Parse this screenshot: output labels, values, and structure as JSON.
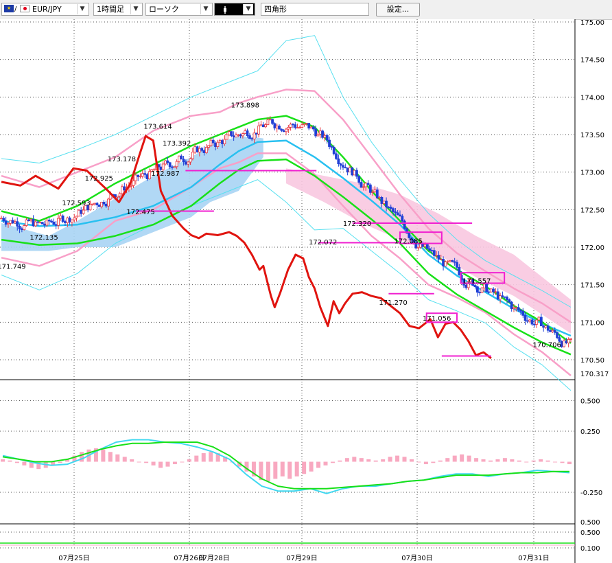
{
  "toolbar": {
    "symbol": "EUR/JPY",
    "timeframe": "1時間足",
    "chart_type": "ローソク",
    "draw_tool_icon": "line-tool-icon",
    "shape": "四角形",
    "settings": "設定..."
  },
  "colors": {
    "candle_up": "#e8323c",
    "candle_down": "#1f3fd6",
    "chikou": "#e0140f",
    "bb_inner": "#f8a0c8",
    "bb_outer": "#58e0f0",
    "ma_short": "#18e018",
    "ma_long": "#28c0f0",
    "kumo_blue": "#a8d4f4",
    "kumo_pink": "#f8c8e0",
    "magenta": "#f020d0"
  },
  "chart_data": {
    "type": "candlestick",
    "price_ticks": [
      "175.00",
      "174.50",
      "174.00",
      "173.50",
      "173.00",
      "172.50",
      "172.00",
      "171.50",
      "171.00",
      "170.50"
    ],
    "current_price": "170.317",
    "x_labels": [
      "07月25日",
      "07月26日",
      "07月28日",
      "07月29日",
      "07月30日",
      "07月31日"
    ],
    "ylim": [
      170.317,
      175.0
    ],
    "price_labels": [
      {
        "text": "171.749",
        "x": 3,
        "y": 171.749
      },
      {
        "text": "172.135",
        "x": 20,
        "y": 172.135
      },
      {
        "text": "172.593",
        "x": 37,
        "y": 172.593
      },
      {
        "text": "172.925",
        "x": 49,
        "y": 172.925
      },
      {
        "text": "173.178",
        "x": 61,
        "y": 173.178
      },
      {
        "text": "172.475",
        "x": 71,
        "y": 172.475
      },
      {
        "text": "173.614",
        "x": 80,
        "y": 173.614
      },
      {
        "text": "172.987",
        "x": 84,
        "y": 172.987
      },
      {
        "text": "173.392",
        "x": 90,
        "y": 173.392
      },
      {
        "text": "173.898",
        "x": 126,
        "y": 173.898
      },
      {
        "text": "172.072",
        "x": 167,
        "y": 172.072
      },
      {
        "text": "172.320",
        "x": 185,
        "y": 172.32
      },
      {
        "text": "172.085",
        "x": 212,
        "y": 172.085
      },
      {
        "text": "171.270",
        "x": 204,
        "y": 171.27
      },
      {
        "text": "171.056",
        "x": 227,
        "y": 171.056
      },
      {
        "text": "171.557",
        "x": 248,
        "y": 171.557
      },
      {
        "text": "170.706",
        "x": 285,
        "y": 170.706
      }
    ],
    "series": [
      {
        "name": "",
        "role": "candles",
        "values": "[open, high, low, close] per hourly bar, 300 bars"
      },
      {
        "name": "",
        "role": "chikou"
      },
      {
        "name": "",
        "role": "ma_short"
      },
      {
        "name": "",
        "role": "ma_long"
      },
      {
        "name": "",
        "role": "bb_inner"
      },
      {
        "name": "",
        "role": "bb_outer"
      }
    ],
    "chikou": [
      [
        0,
        172.87
      ],
      [
        10,
        172.82
      ],
      [
        18,
        172.95
      ],
      [
        30,
        172.78
      ],
      [
        38,
        173.05
      ],
      [
        45,
        173.02
      ],
      [
        55,
        172.78
      ],
      [
        62,
        172.6
      ],
      [
        68,
        172.85
      ],
      [
        73,
        173.25
      ],
      [
        76,
        173.48
      ],
      [
        80,
        173.42
      ],
      [
        84,
        172.75
      ],
      [
        90,
        172.42
      ],
      [
        96,
        172.25
      ],
      [
        100,
        172.16
      ],
      [
        104,
        172.12
      ],
      [
        108,
        172.18
      ],
      [
        114,
        172.16
      ],
      [
        120,
        172.2
      ],
      [
        124,
        172.15
      ],
      [
        128,
        172.06
      ],
      [
        132,
        171.9
      ],
      [
        136,
        171.7
      ],
      [
        138,
        171.75
      ],
      [
        140,
        171.55
      ],
      [
        142,
        171.35
      ],
      [
        144,
        171.2
      ],
      [
        147,
        171.4
      ],
      [
        151,
        171.7
      ],
      [
        155,
        171.9
      ],
      [
        159,
        171.85
      ],
      [
        162,
        171.6
      ],
      [
        165,
        171.45
      ],
      [
        168,
        171.2
      ],
      [
        172,
        170.95
      ],
      [
        175,
        171.28
      ],
      [
        178,
        171.12
      ],
      [
        181,
        171.25
      ],
      [
        185,
        171.38
      ],
      [
        190,
        171.4
      ],
      [
        195,
        171.35
      ],
      [
        200,
        171.32
      ],
      [
        205,
        171.22
      ],
      [
        210,
        171.12
      ],
      [
        215,
        170.95
      ],
      [
        220,
        170.92
      ],
      [
        226,
        171.04
      ],
      [
        230,
        170.8
      ],
      [
        234,
        170.98
      ],
      [
        238,
        171.0
      ],
      [
        242,
        170.9
      ],
      [
        246,
        170.75
      ],
      [
        250,
        170.56
      ],
      [
        254,
        170.6
      ],
      [
        258,
        170.52
      ]
    ],
    "ma_short": [
      [
        0,
        172.48
      ],
      [
        20,
        172.35
      ],
      [
        40,
        172.55
      ],
      [
        60,
        172.85
      ],
      [
        80,
        173.1
      ],
      [
        100,
        173.35
      ],
      [
        115,
        173.5
      ],
      [
        125,
        173.6
      ],
      [
        135,
        173.7
      ],
      [
        150,
        173.75
      ],
      [
        165,
        173.6
      ],
      [
        180,
        173.2
      ],
      [
        195,
        172.75
      ],
      [
        210,
        172.35
      ],
      [
        225,
        171.95
      ],
      [
        240,
        171.7
      ],
      [
        255,
        171.48
      ],
      [
        270,
        171.22
      ],
      [
        285,
        171.0
      ],
      [
        300,
        170.72
      ]
    ],
    "ma_long": [
      [
        0,
        172.35
      ],
      [
        20,
        172.28
      ],
      [
        40,
        172.3
      ],
      [
        60,
        172.4
      ],
      [
        80,
        172.55
      ],
      [
        100,
        172.8
      ],
      [
        115,
        173.1
      ],
      [
        125,
        173.28
      ],
      [
        135,
        173.4
      ],
      [
        150,
        173.42
      ],
      [
        165,
        173.2
      ],
      [
        180,
        172.92
      ],
      [
        195,
        172.62
      ],
      [
        210,
        172.3
      ],
      [
        225,
        171.9
      ],
      [
        240,
        171.62
      ],
      [
        255,
        171.4
      ],
      [
        270,
        171.18
      ],
      [
        285,
        170.98
      ],
      [
        300,
        170.82
      ]
    ],
    "bb_inner": [
      [
        0,
        172.95
      ],
      [
        20,
        172.8
      ],
      [
        40,
        173.0
      ],
      [
        60,
        173.2
      ],
      [
        80,
        173.55
      ],
      [
        100,
        173.75
      ],
      [
        115,
        173.8
      ],
      [
        125,
        173.92
      ],
      [
        135,
        174.0
      ],
      [
        150,
        174.1
      ],
      [
        165,
        174.08
      ],
      [
        180,
        173.7
      ],
      [
        195,
        173.2
      ],
      [
        210,
        172.7
      ],
      [
        225,
        172.25
      ],
      [
        240,
        171.92
      ],
      [
        255,
        171.68
      ],
      [
        270,
        171.45
      ],
      [
        285,
        171.25
      ],
      [
        300,
        171.0
      ]
    ],
    "bb_outer": [
      [
        0,
        173.18
      ],
      [
        20,
        173.12
      ],
      [
        40,
        173.3
      ],
      [
        60,
        173.5
      ],
      [
        80,
        173.75
      ],
      [
        100,
        174.0
      ],
      [
        115,
        174.15
      ],
      [
        125,
        174.25
      ],
      [
        135,
        174.35
      ],
      [
        150,
        174.75
      ],
      [
        165,
        174.82
      ],
      [
        180,
        174.0
      ],
      [
        195,
        173.4
      ],
      [
        210,
        172.9
      ],
      [
        225,
        172.45
      ],
      [
        240,
        172.1
      ],
      [
        255,
        171.82
      ],
      [
        270,
        171.62
      ],
      [
        285,
        171.42
      ],
      [
        300,
        171.2
      ]
    ],
    "boxes": [
      {
        "label": "172.085",
        "x1": 210,
        "x2": 232,
        "y1": 172.05,
        "y2": 172.2
      },
      {
        "label": "171.056",
        "x1": 224,
        "x2": 240,
        "y1": 171.0,
        "y2": 171.12
      },
      {
        "label": "171.557",
        "x1": 242,
        "x2": 265,
        "y1": 171.52,
        "y2": 171.66
      }
    ],
    "hlines": [
      {
        "y": 172.48,
        "x1": 71,
        "x2": 112
      },
      {
        "y": 173.02,
        "x1": 97,
        "x2": 166
      },
      {
        "y": 172.32,
        "x1": 185,
        "x2": 248
      },
      {
        "y": 172.06,
        "x1": 167,
        "x2": 210
      },
      {
        "y": 171.38,
        "x1": 204,
        "x2": 228
      },
      {
        "y": 171.0,
        "x1": 225,
        "x2": 240
      },
      {
        "y": 170.55,
        "x1": 232,
        "x2": 258
      }
    ],
    "macd": {
      "ticks": [
        "0.500",
        "0.250",
        "-0.250"
      ],
      "hist": [
        0.02,
        0.01,
        -0.01,
        -0.03,
        -0.05,
        -0.06,
        -0.05,
        -0.03,
        -0.01,
        0.02,
        0.05,
        0.08,
        0.1,
        0.11,
        0.1,
        0.08,
        0.06,
        0.04,
        0.02,
        0.0,
        -0.01,
        -0.03,
        -0.05,
        -0.04,
        -0.02,
        0.0,
        0.02,
        0.05,
        0.07,
        0.08,
        0.07,
        0.04,
        0.0,
        -0.04,
        -0.08,
        -0.12,
        -0.15,
        -0.16,
        -0.14,
        -0.12,
        -0.14,
        -0.12,
        -0.1,
        -0.08,
        -0.05,
        -0.03,
        -0.01,
        0.01,
        0.03,
        0.04,
        0.03,
        0.02,
        0.01,
        0.02,
        0.04,
        0.05,
        0.04,
        0.02,
        0.0,
        -0.02,
        -0.01,
        0.01,
        0.03,
        0.05,
        0.06,
        0.05,
        0.03,
        0.02,
        0.01,
        0.02,
        0.03,
        0.02,
        0.01,
        0.0,
        0.01,
        0.02,
        0.01,
        0.0,
        -0.01,
        -0.02
      ],
      "line1": [
        0.05,
        0.02,
        -0.01,
        -0.03,
        -0.02,
        0.03,
        0.1,
        0.16,
        0.18,
        0.18,
        0.16,
        0.15,
        0.12,
        0.08,
        0.02,
        -0.1,
        -0.2,
        -0.24,
        -0.24,
        -0.22,
        -0.26,
        -0.22,
        -0.2,
        -0.2,
        -0.18,
        -0.16,
        -0.15,
        -0.12,
        -0.1,
        -0.1,
        -0.12,
        -0.1,
        -0.09,
        -0.07,
        -0.08,
        -0.09
      ],
      "line2": [
        0.04,
        0.02,
        0.0,
        0.0,
        0.02,
        0.06,
        0.1,
        0.13,
        0.15,
        0.15,
        0.16,
        0.16,
        0.16,
        0.12,
        0.05,
        -0.05,
        -0.14,
        -0.2,
        -0.22,
        -0.22,
        -0.22,
        -0.21,
        -0.2,
        -0.19,
        -0.18,
        -0.16,
        -0.15,
        -0.13,
        -0.11,
        -0.11,
        -0.11,
        -0.1,
        -0.09,
        -0.09,
        -0.08,
        -0.08
      ]
    },
    "rsi": {
      "ticks": [
        "0.500",
        "0.100"
      ]
    }
  }
}
